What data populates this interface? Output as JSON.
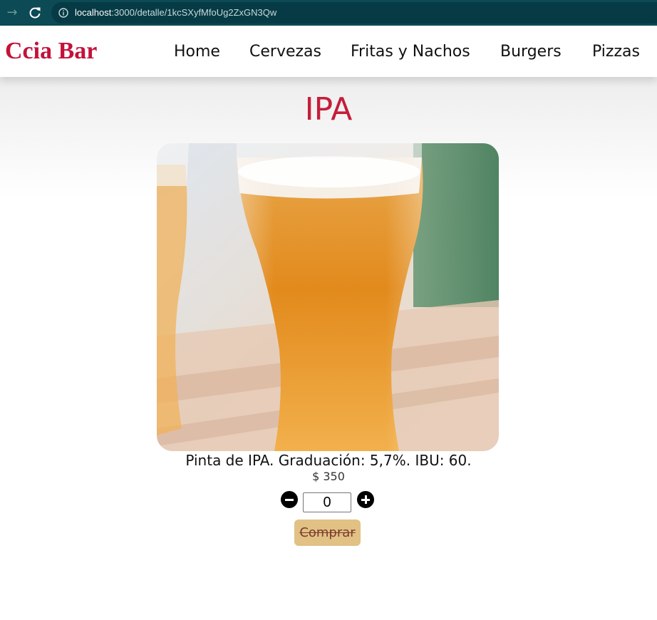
{
  "browser": {
    "url_host": "localhost",
    "url_path": ":3000/detalle/1kcSXyfMfoUg2ZxGN3Qw",
    "icons": [
      "back-arrow-icon",
      "reload-icon",
      "info-icon"
    ]
  },
  "navbar": {
    "brand": "Ccia Bar",
    "links": [
      {
        "label": "Home"
      },
      {
        "label": "Cervezas"
      },
      {
        "label": "Fritas y Nachos"
      },
      {
        "label": "Burgers"
      },
      {
        "label": "Pizzas"
      }
    ]
  },
  "product": {
    "title": "IPA",
    "image_alt": "beer-glass-photo",
    "description": "Pinta de IPA. Graduación: 5,7%. IBU: 60.",
    "price": "$ 350",
    "quantity": "0",
    "buy_label": "Comprar",
    "icons": [
      "minus-circle-icon",
      "plus-circle-icon"
    ]
  },
  "colors": {
    "browser_bar": "#0c4a55",
    "brand": "#c4123a",
    "title": "#c41e3a",
    "buy_button_bg": "#e1c184",
    "buy_button_text": "#7a3b2e"
  }
}
